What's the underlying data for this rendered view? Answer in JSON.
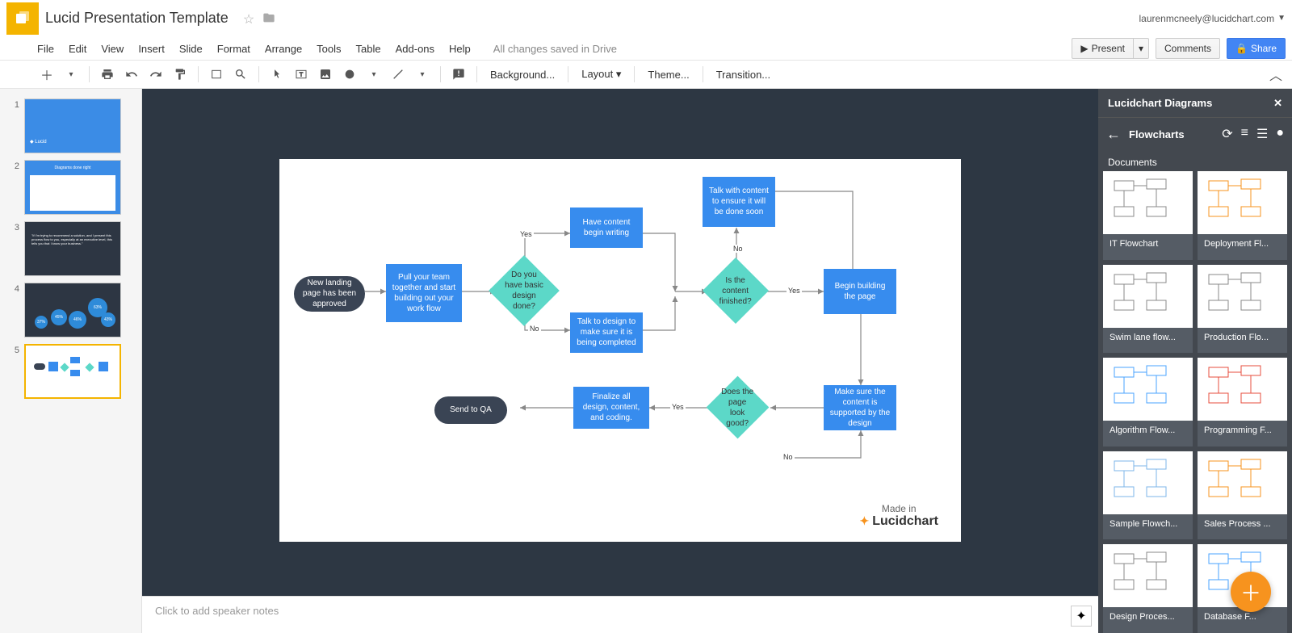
{
  "header": {
    "doc_title": "Lucid Presentation Template",
    "user_email": "laurenmcneely@lucidchart.com"
  },
  "menubar": {
    "items": [
      "File",
      "Edit",
      "View",
      "Insert",
      "Slide",
      "Format",
      "Arrange",
      "Tools",
      "Table",
      "Add-ons",
      "Help"
    ],
    "save_status": "All changes saved in Drive",
    "present": "Present",
    "comments": "Comments",
    "share": "Share"
  },
  "toolbar": {
    "background": "Background...",
    "layout": "Layout",
    "theme": "Theme...",
    "transition": "Transition..."
  },
  "thumbnails": [
    1,
    2,
    3,
    4,
    5
  ],
  "flowchart": {
    "nodes": {
      "start": "New landing page has been approved",
      "pull": "Pull your team together and start building out your work flow",
      "d1": "Do you have basic design done?",
      "write": "Have content begin writing",
      "talk_design": "Talk to design to make sure it is being completed",
      "d2": "Is the content finished?",
      "talk_content": "Talk with content to ensure it will be done soon",
      "build": "Begin building the page",
      "support": "Make sure the content is supported by the design",
      "d3": "Does the page look good?",
      "finalize": "Finalize all design, content, and coding.",
      "qa": "Send to QA"
    },
    "labels": {
      "yes": "Yes",
      "no": "No"
    },
    "branding_top": "Made in",
    "branding_name": "Lucidchart"
  },
  "notes": {
    "placeholder": "Click to add speaker notes"
  },
  "sidebar": {
    "title": "Lucidchart Diagrams",
    "nav_title": "Flowcharts",
    "section": "Documents",
    "cards": [
      "IT Flowchart",
      "Deployment Fl...",
      "Swim lane flow...",
      "Production Flo...",
      "Algorithm Flow...",
      "Programming F...",
      "Sample Flowch...",
      "Sales Process ...",
      "Design Proces...",
      "Database F..."
    ]
  }
}
